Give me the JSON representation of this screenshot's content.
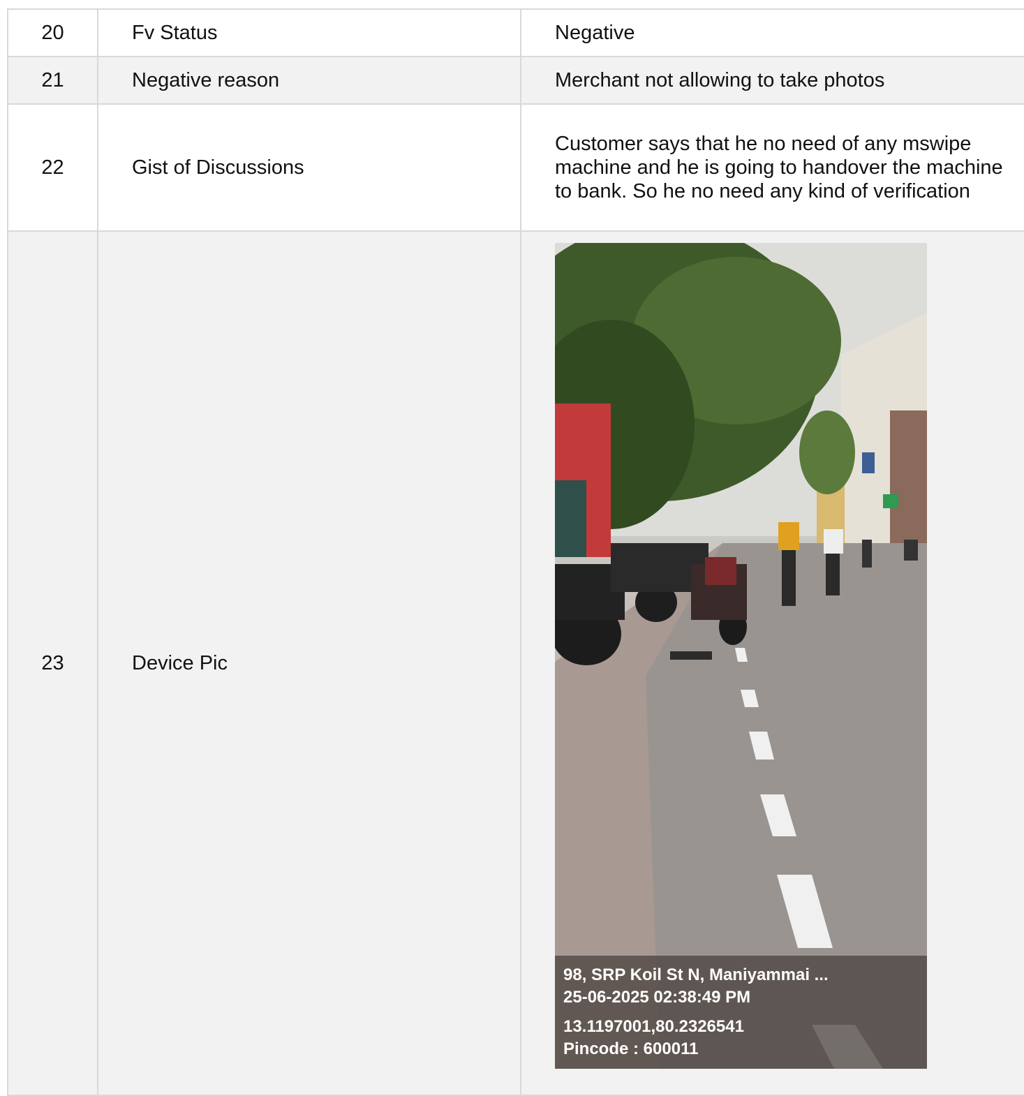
{
  "rows": [
    {
      "no": "20",
      "label": "Fv Status",
      "value": "Negative"
    },
    {
      "no": "21",
      "label": "Negative reason",
      "value": "Merchant not allowing to take photos"
    },
    {
      "no": "22",
      "label": "Gist of Discussions",
      "value": "Customer says that he no need of any mswipe machine and he is going to handover the machine to bank. So he no need any kind of verification"
    },
    {
      "no": "23",
      "label": "Device Pic"
    }
  ],
  "device_pic": {
    "address": "98, SRP Koil St N, Maniyammai ...",
    "datetime": "25-06-2025 02:38:49 PM",
    "coordinates": "13.1197001,80.2326541",
    "pincode": "Pincode : 600011"
  }
}
